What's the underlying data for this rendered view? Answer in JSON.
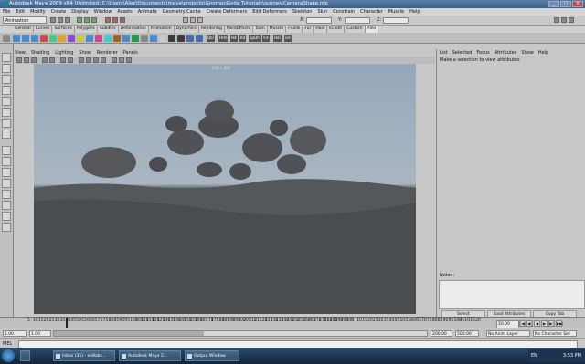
{
  "window": {
    "title": "Autodesk Maya 2009 x64 Unlimited: C:\\Users\\Alex\\Documents\\maya\\projects\\GnomonGoda Tutorials\\scenes\\CameraShake.mb",
    "controls": [
      "_",
      "□",
      "×"
    ]
  },
  "menubar": [
    "File",
    "Edit",
    "Modify",
    "Create",
    "Display",
    "Window",
    "Assets",
    "Animate",
    "Geometry Cache",
    "Create Deformers",
    "Edit Deformers",
    "Skeleton",
    "Skin",
    "Constrain",
    "Character",
    "Muscle",
    "Help"
  ],
  "statusline": {
    "mode": "Animation",
    "coord_labels": [
      "X:",
      "Y:",
      "Z:"
    ]
  },
  "shelf": {
    "tabs": [
      "General",
      "Curves",
      "Surfaces",
      "Polygons",
      "Subdivs",
      "Deformation",
      "Animation",
      "Dynamics",
      "Rendering",
      "PaintEffects",
      "Toon",
      "Muscle",
      "Fluids",
      "Fur",
      "Hair",
      "nCloth",
      "Custom",
      "Alex"
    ],
    "active_tab": "Alex",
    "text_icons": [
      "Dbl",
      "Hrm",
      "Hd",
      "Kd",
      "SpDh",
      "Vis",
      "Hal",
      "sel"
    ]
  },
  "panel": {
    "menu": [
      "View",
      "Shading",
      "Lighting",
      "Show",
      "Renderer",
      "Panels"
    ],
    "resolution_gate": "640 x 480"
  },
  "attribute_editor": {
    "menu": [
      "List",
      "Selected",
      "Focus",
      "Attributes",
      "Show",
      "Help"
    ],
    "message": "Make a selection to view attributes",
    "notes_label": "Notes:",
    "buttons": [
      "Select",
      "Load Attributes",
      "Copy Tab"
    ]
  },
  "timeline": {
    "ticks": [
      "5",
      "10",
      "15",
      "20",
      "25",
      "30",
      "35",
      "40",
      "45",
      "50",
      "55",
      "60",
      "65",
      "70",
      "75",
      "80",
      "85",
      "90",
      "95",
      "100",
      "105",
      "110",
      "115",
      "120",
      "125",
      "130",
      "135",
      "140",
      "145",
      "150",
      "155",
      "160",
      "165",
      "170",
      "175",
      "180",
      "185",
      "190",
      "195",
      "200",
      "205",
      "210",
      "215",
      "220",
      "225",
      "230",
      "235",
      "240",
      "245",
      "250",
      "255",
      "260",
      "265",
      "270",
      "275",
      "280",
      "285",
      "290",
      "295",
      "300",
      "5",
      "10",
      "15",
      "20",
      "25",
      "30",
      "35",
      "40",
      "45",
      "50",
      "55",
      "60",
      "65",
      "70",
      "75",
      "80",
      "85",
      "90",
      "95",
      "100",
      "05",
      "10",
      "15",
      "20"
    ],
    "current_frame": "20.00",
    "playback_buttons": [
      "|◀",
      "◀|",
      "◀",
      "▶",
      "▶|",
      "▶▶|"
    ]
  },
  "range": {
    "start": "1.00",
    "playback_start": "1.00",
    "playback_end": "200.00",
    "end": "500.00",
    "anim_layer": "No Anim Layer",
    "character_set": "No Character Set"
  },
  "command_line": {
    "label": "MEL"
  },
  "taskbar": {
    "items": [
      "Inbox (35) - en8abc...",
      "Autodesk Maya 2...",
      "Output Window"
    ],
    "lang": "EN",
    "clock": "3:53 PM"
  },
  "colors": {
    "sky": "#9aaebf",
    "ground": "#4e5052",
    "rock": "#4a4c4e",
    "title_bar": "#3b5e8d"
  }
}
